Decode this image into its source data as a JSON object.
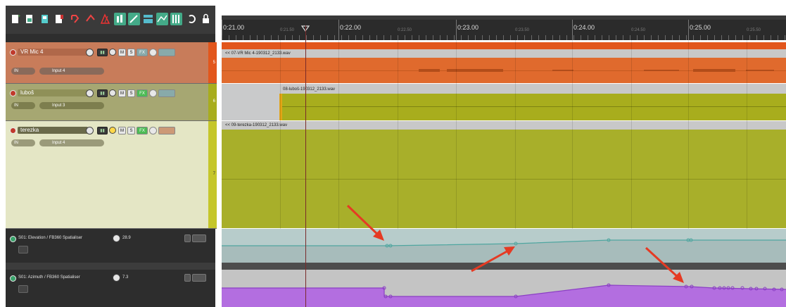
{
  "toolbar": {
    "icons": [
      "new-project-icon",
      "open-project-icon",
      "save-project-icon",
      "render-icon",
      "undo-icon",
      "redo-icon",
      "metronome-icon",
      "snap-icon",
      "ripple-edit-icon",
      "grid-icon",
      "envelope-icon",
      "mixer-icon",
      "loop-icon",
      "lock-icon"
    ]
  },
  "ruler": {
    "labels": [
      "0:21.00",
      "0:21.50",
      "0:22.00",
      "0:22.50",
      "0:23.00",
      "0:23.50",
      "0:24.00",
      "0:24.50",
      "0:25.00",
      "0:25.50"
    ]
  },
  "tracks": [
    {
      "name": "VR Mic 4",
      "input": "Input 4",
      "io": "IN",
      "mute": "M",
      "solo": "S",
      "fx": "FX",
      "number": "5",
      "item_name": "<< 07-VR Mic 4-190312_2133.wav",
      "color": "#e06a2d"
    },
    {
      "name": "luboš",
      "input": "Input 3",
      "io": "IN",
      "mute": "M",
      "solo": "S",
      "fx": "FX",
      "number": "6",
      "item_name": "08-luboš-190312_2133.wav",
      "color": "#a5a919"
    },
    {
      "name": "terezka",
      "input": "Input 4",
      "io": "IN",
      "mute": "M",
      "solo": "S",
      "fx": "FX",
      "number": "7",
      "item_name": "<< 09-terezka-190312_2133.wav",
      "color": "#a8af2a"
    }
  ],
  "envelopes": [
    {
      "label": "S01: Elevation / FB360 Spatialiser",
      "value": "28.9"
    },
    {
      "label": "S01: Azimuth / FB360 Spatialiser",
      "value": "7.3"
    }
  ]
}
